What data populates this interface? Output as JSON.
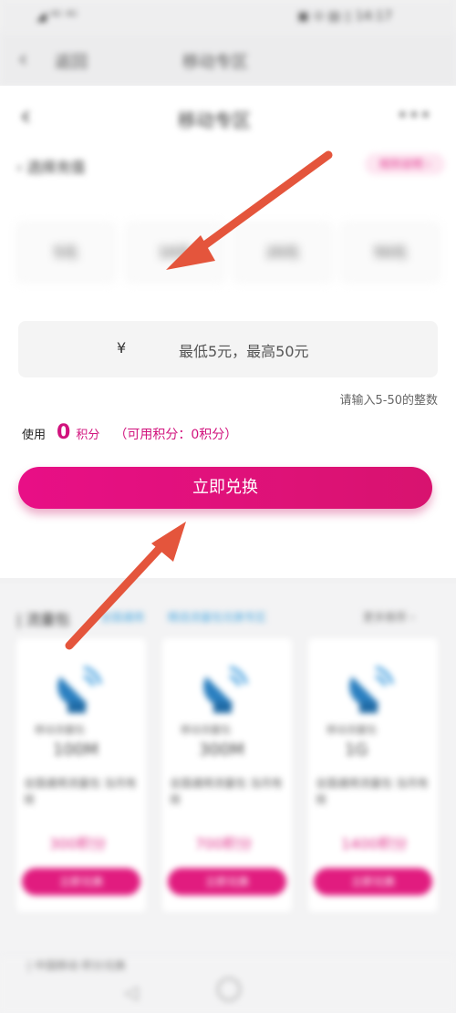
{
  "status_bar": {
    "left": "◢ ⁴ᴳ ⁴ᴳ",
    "right": "▣ ⊙ ▤ ▯ 14:17"
  },
  "app_nav": {
    "back": "‹",
    "tab1": "返回",
    "tab2": "移动专区"
  },
  "header": {
    "back": "‹",
    "title": "移动专区",
    "more": "•••"
  },
  "section": {
    "label": "‹ 选择充值",
    "pill": "规则说明 ›"
  },
  "options": [
    "5元",
    "10元",
    "20元",
    "50元"
  ],
  "amount": {
    "currency": "¥",
    "placeholder": "最低5元，最高50元"
  },
  "hint": "请输入5-50的整数",
  "points": {
    "use_label": "使用",
    "value": "0",
    "unit": "积分",
    "available": "（可用积分：0积分）"
  },
  "redeem_button": "立即兑换",
  "lower_section": {
    "title": "| 流量包",
    "tab_a": "全国通用",
    "tab_b": "精选流量包兑换专区",
    "more": "更多推荐 ›"
  },
  "cards": [
    {
      "line1": "移动流量包",
      "amount": "100M",
      "desc": "全国通用流量包 当月有效",
      "price": "300积分",
      "button": "立即兑换"
    },
    {
      "line1": "移动流量包",
      "amount": "300M",
      "desc": "全国通用流量包 当月有效",
      "price": "700积分",
      "button": "立即兑换"
    },
    {
      "line1": "移动流量包",
      "amount": "1G",
      "desc": "全国通用流量包 当月有效",
      "price": "1400积分",
      "button": "立即兑换"
    }
  ],
  "footer_text": "| 中国移动 积分兑换",
  "colors": {
    "accent": "#d1127d",
    "button": "#e80f86",
    "arrow": "#e4553c"
  }
}
